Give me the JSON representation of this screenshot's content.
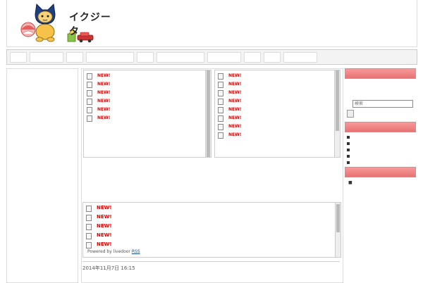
{
  "header": {
    "title": "イクジータ",
    "description": ""
  },
  "nav": [
    {
      "label": "",
      "w": "w20"
    },
    {
      "label": "",
      "w": "w40"
    },
    {
      "label": "",
      "w": "w20"
    },
    {
      "label": "",
      "w": "w60"
    },
    {
      "label": "",
      "w": "w20"
    },
    {
      "label": "",
      "w": "w60"
    },
    {
      "label": "",
      "w": "w40"
    },
    {
      "label": "",
      "w": "w20"
    },
    {
      "label": "",
      "w": "w20"
    },
    {
      "label": "",
      "w": "w40"
    }
  ],
  "rss_left": {
    "items": [
      {
        "text": "",
        "new": "NEW!"
      },
      {
        "text": "",
        "new": "NEW!"
      },
      {
        "text": "",
        "new": "NEW!"
      },
      {
        "text": "",
        "new": "NEW!"
      },
      {
        "text": "",
        "new": "NEW!"
      },
      {
        "text": "",
        "new": "NEW!"
      }
    ]
  },
  "rss_right": {
    "items": [
      {
        "text": "",
        "new": "NEW!"
      },
      {
        "text": "",
        "new": "NEW!"
      },
      {
        "text": "",
        "new": "NEW!"
      },
      {
        "text": "",
        "new": "NEW!"
      },
      {
        "text": "",
        "new": "NEW!"
      },
      {
        "text": "",
        "new": "NEW!"
      },
      {
        "text": "",
        "new": "NEW!"
      },
      {
        "text": "",
        "new": "NEW!"
      }
    ]
  },
  "rss_wide": {
    "items": [
      {
        "text": "",
        "new": "NEW!"
      },
      {
        "text": "",
        "new": "NEW!"
      },
      {
        "text": "",
        "new": "NEW!"
      },
      {
        "text": "",
        "new": "NEW!"
      },
      {
        "text": "",
        "new": "NEW!"
      }
    ],
    "powered_prefix": "Powered by livedoor",
    "rss_link": "RSS"
  },
  "entry": {
    "date": "2014年11月7日 16:15",
    "title": ""
  },
  "sidebar": {
    "about": {
      "heading": "",
      "text": "",
      "link": ""
    },
    "search": {
      "label": "",
      "placeholder": "検索",
      "button": ""
    },
    "links": {
      "heading": "",
      "items": [
        "",
        "",
        "",
        "",
        ""
      ]
    },
    "categories": {
      "heading": "",
      "root": "",
      "items": [
        "",
        "",
        "",
        "",
        "",
        "",
        "",
        "",
        ""
      ]
    }
  },
  "colors": {
    "accent": "#e97171",
    "link": "#1a4b8c",
    "new": "#e00000"
  }
}
